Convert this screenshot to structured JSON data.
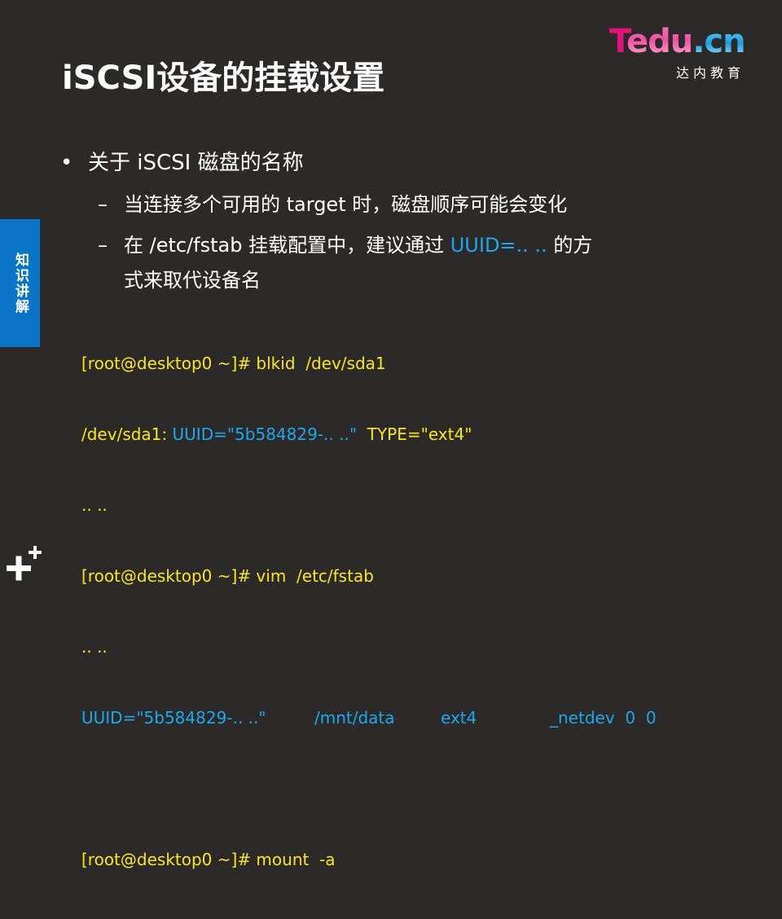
{
  "logo": {
    "brand_t": "T",
    "brand_edu": "edu",
    "brand_dot_cn": ".cn",
    "subtitle": "达内教育"
  },
  "slide_title": "iSCSI设备的挂载设置",
  "side_tab": "知识讲解",
  "bullets": {
    "main": "关于 iSCSI 磁盘的名称",
    "sub1": "当连接多个可用的 target 时，磁盘顺序可能会变化",
    "sub2_prefix": "在 /etc/fstab 挂载配置中，建议通过 ",
    "sub2_highlight": "UUID=.. ..",
    "sub2_suffix": " 的方",
    "sub2_cont": "式来取代设备名",
    "bullet_glyph": "•",
    "dash_glyph": "–"
  },
  "code": {
    "line1": "[root@desktop0 ~]# blkid  /dev/sda1",
    "line2_prefix": "/dev/sda1: ",
    "line2_uuid": "UUID=\"5b584829-.. ..\"",
    "line2_type": "  TYPE=\"ext4\"",
    "line3": ".. ..",
    "line4": "[root@desktop0 ~]# vim  /etc/fstab",
    "line5": ".. ..",
    "fstab": {
      "uuid": "UUID=\"5b584829-.. ..\"",
      "mount": "/mnt/data",
      "fs": "ext4",
      "opts": "_netdev  0  0"
    },
    "line7": "[root@desktop0 ~]# mount  -a"
  },
  "colors": {
    "background": "#2b2a29",
    "accent_blue": "#1ea7ea",
    "code_yellow": "#f8e71c",
    "side_tab": "#0a74c7",
    "logo_pink": "#e5127d"
  },
  "icons": {
    "corner": "plus-plus-icon"
  }
}
